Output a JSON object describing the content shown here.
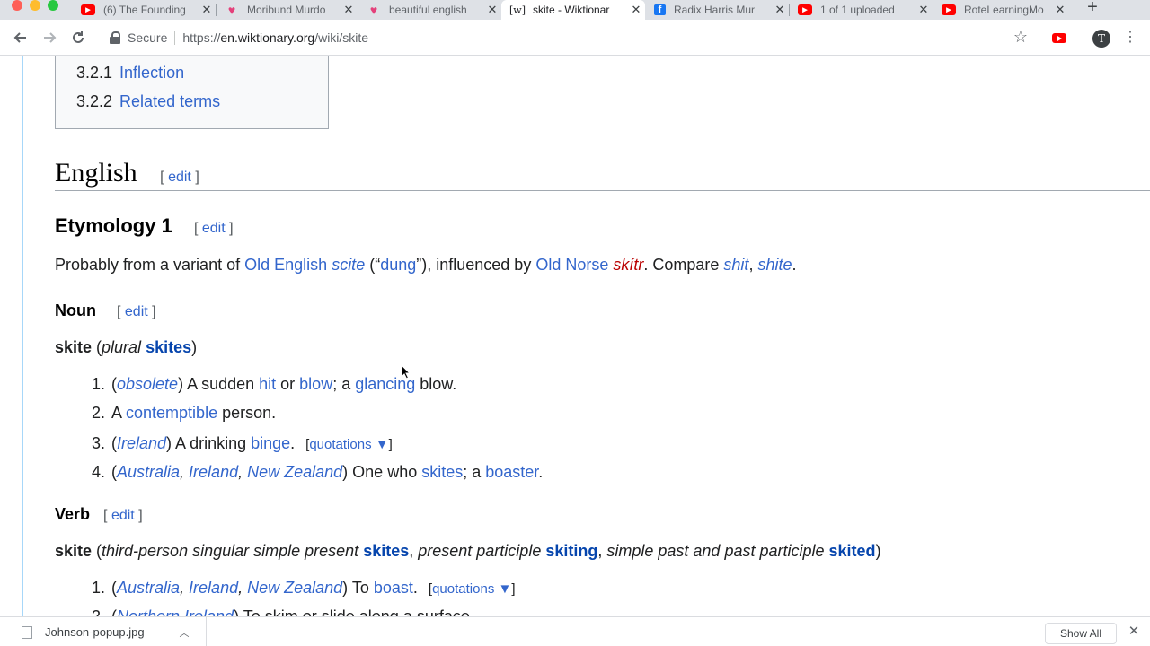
{
  "tabs": [
    {
      "title": "(6) The Founding",
      "favicon": "youtube-icon"
    },
    {
      "title": "Moribund Murdo",
      "favicon": "heart-icon"
    },
    {
      "title": "beautiful english",
      "favicon": "heart-icon"
    },
    {
      "title": "skite - Wiktionar",
      "favicon": "wiktionary-icon",
      "active": true
    },
    {
      "title": "Radix Harris Mur",
      "favicon": "facebook-icon"
    },
    {
      "title": "1 of 1 uploaded",
      "favicon": "youtube-icon"
    },
    {
      "title": "RoteLearningMo",
      "favicon": "youtube-icon"
    }
  ],
  "favicon_text": {
    "youtube": "▶",
    "facebook": "f",
    "wiktionary": "[w]",
    "heart": "♥"
  },
  "toolbar": {
    "secure_label": "Secure",
    "url_prefix": "https://",
    "url_host": "en.wiktionary.org",
    "url_path": "/wiki/skite",
    "avatar_letter": "T"
  },
  "toc": [
    {
      "num": "3.2.1",
      "label": "Inflection"
    },
    {
      "num": "3.2.2",
      "label": "Related terms"
    }
  ],
  "edit_text": {
    "open": "[",
    "label": "edit",
    "close": "]"
  },
  "english": {
    "heading": "English"
  },
  "etymology": {
    "heading": "Etymology 1",
    "parts": {
      "p1": "Probably from a variant of ",
      "old_english": "Old English",
      "scite": "scite",
      "p2": " (“",
      "dung": "dung",
      "p3": "”), influenced by ",
      "old_norse": "Old Norse",
      "skitr": "skítr",
      "p4": ". Compare ",
      "shit": "shit",
      "p5": ", ",
      "shite": "shite",
      "p6": "."
    }
  },
  "noun": {
    "heading": "Noun",
    "headword": "skite",
    "plural_label": "plural",
    "plural_form": "skites",
    "defs": [
      {
        "num": "1.",
        "label": "obsolete",
        "t1": " A sudden ",
        "l1": "hit",
        "t2": " or ",
        "l2": "blow",
        "t3": "; a ",
        "l3": "glancing",
        "t4": " blow."
      },
      {
        "num": "2.",
        "t1": "A ",
        "l1": "contemptible",
        "t2": " person."
      },
      {
        "num": "3.",
        "label": "Ireland",
        "t1": " A drinking ",
        "l1": "binge",
        "t2": "."
      },
      {
        "num": "4.",
        "labels": [
          "Australia",
          "Ireland",
          "New Zealand"
        ],
        "t1": " One who ",
        "l1": "skites",
        "t2": "; a ",
        "l2": "boaster",
        "t3": "."
      }
    ]
  },
  "quotations": {
    "label": "quotations",
    "arrow": "▼"
  },
  "verb": {
    "heading": "Verb",
    "headword": "skite",
    "f1_label": "third-person singular simple present",
    "f1": "skites",
    "f2_label": "present participle",
    "f2": "skiting",
    "f3_label": "simple past and past participle",
    "f3": "skited",
    "defs": [
      {
        "num": "1.",
        "labels": [
          "Australia",
          "Ireland",
          "New Zealand"
        ],
        "t1": " To ",
        "l1": "boast",
        "t2": "."
      },
      {
        "num": "2.",
        "label": "Northern Ireland",
        "t1": " To skim or slide along a surface."
      }
    ]
  },
  "downloads": {
    "file": "Johnson-popup.jpg",
    "show_all": "Show All"
  }
}
